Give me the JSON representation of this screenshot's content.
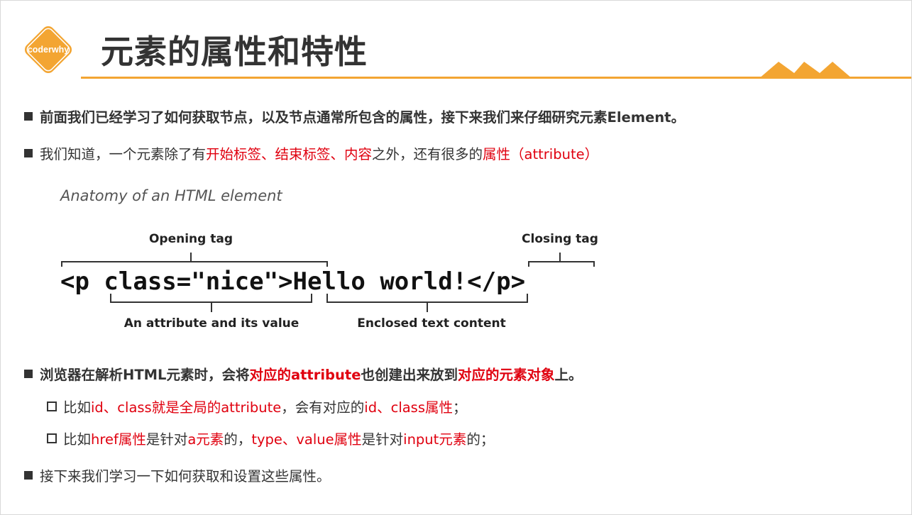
{
  "logo": {
    "text": "coderwhy"
  },
  "title": "元素的属性和特性",
  "bullets": {
    "b1": {
      "text": "前面我们已经学习了如何获取节点，以及节点通常所包含的属性，接下来我们来仔细研究元素Element。"
    },
    "b2": {
      "p1": "我们知道，一个元素除了有",
      "p2": "开始标签、结束标签、内容",
      "p3": "之外，还有很多的",
      "p4": "属性（attribute）"
    },
    "b3": {
      "p1": "浏览器在解析HTML元素时，会将",
      "p2": "对应的attribute",
      "p3": "也创建出来放到",
      "p4": "对应的元素对象",
      "p5": "上。"
    },
    "b3s1": {
      "p1": "比如",
      "p2": "id、class就是全局的attribute",
      "p3": "，会有对应的",
      "p4": "id、class属性",
      "p5": "；"
    },
    "b3s2": {
      "p1": "比如",
      "p2": "href属性",
      "p3": "是针对",
      "p4": "a元素",
      "p5": "的，",
      "p6": "type、value属性",
      "p7": "是针对",
      "p8": "input元素",
      "p9": "的；"
    },
    "b4": {
      "text": "接下来我们学习一下如何获取和设置这些属性。"
    }
  },
  "figure": {
    "caption": "Anatomy of an HTML element",
    "opening_tag": "Opening tag",
    "closing_tag": "Closing tag",
    "attribute_label": "An attribute and its value",
    "content_label": "Enclosed text content",
    "code_open": "<p class=\"nice\">",
    "code_content": "Hello world!",
    "code_close": "</p>"
  },
  "colors": {
    "accent": "#f3a532",
    "emphasis": "#e0000f",
    "text": "#333333"
  }
}
